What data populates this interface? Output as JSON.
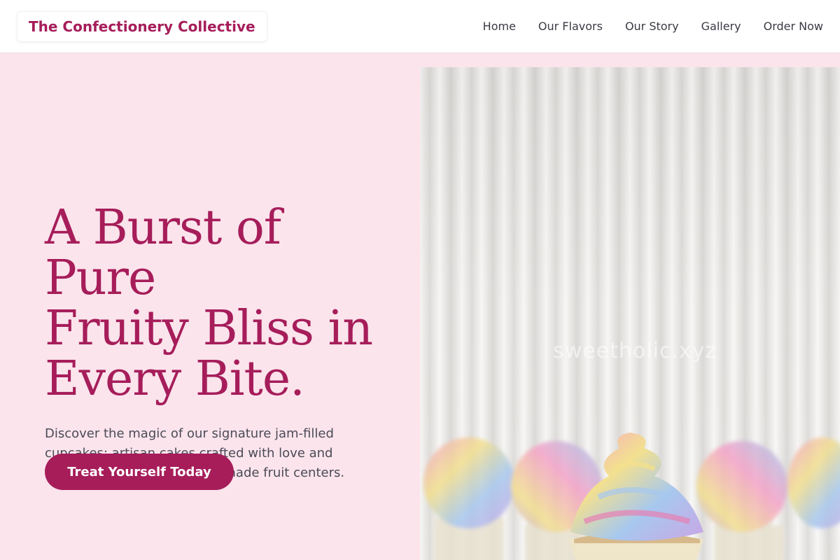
{
  "nav": {
    "brand": "The Confectionery Collective",
    "links": [
      "Home",
      "Our Flavors",
      "Our Story",
      "Gallery",
      "Order Now"
    ]
  },
  "hero": {
    "headline_lines": [
      "A Burst of Pure",
      "Fruity Bliss in",
      "Every Bite."
    ],
    "subtitle": "Discover the magic of our signature jam-filled cupcakes: artisan cakes crafted with love and crowned with luscious, handmade fruit centers.",
    "cta_label": "Treat Yourself Today"
  },
  "image": {
    "watermark": "sweetholic.xyz"
  },
  "colors": {
    "brand": "#a61d5a",
    "background": "#fbe4ec",
    "nav_text": "#3a3a44"
  }
}
